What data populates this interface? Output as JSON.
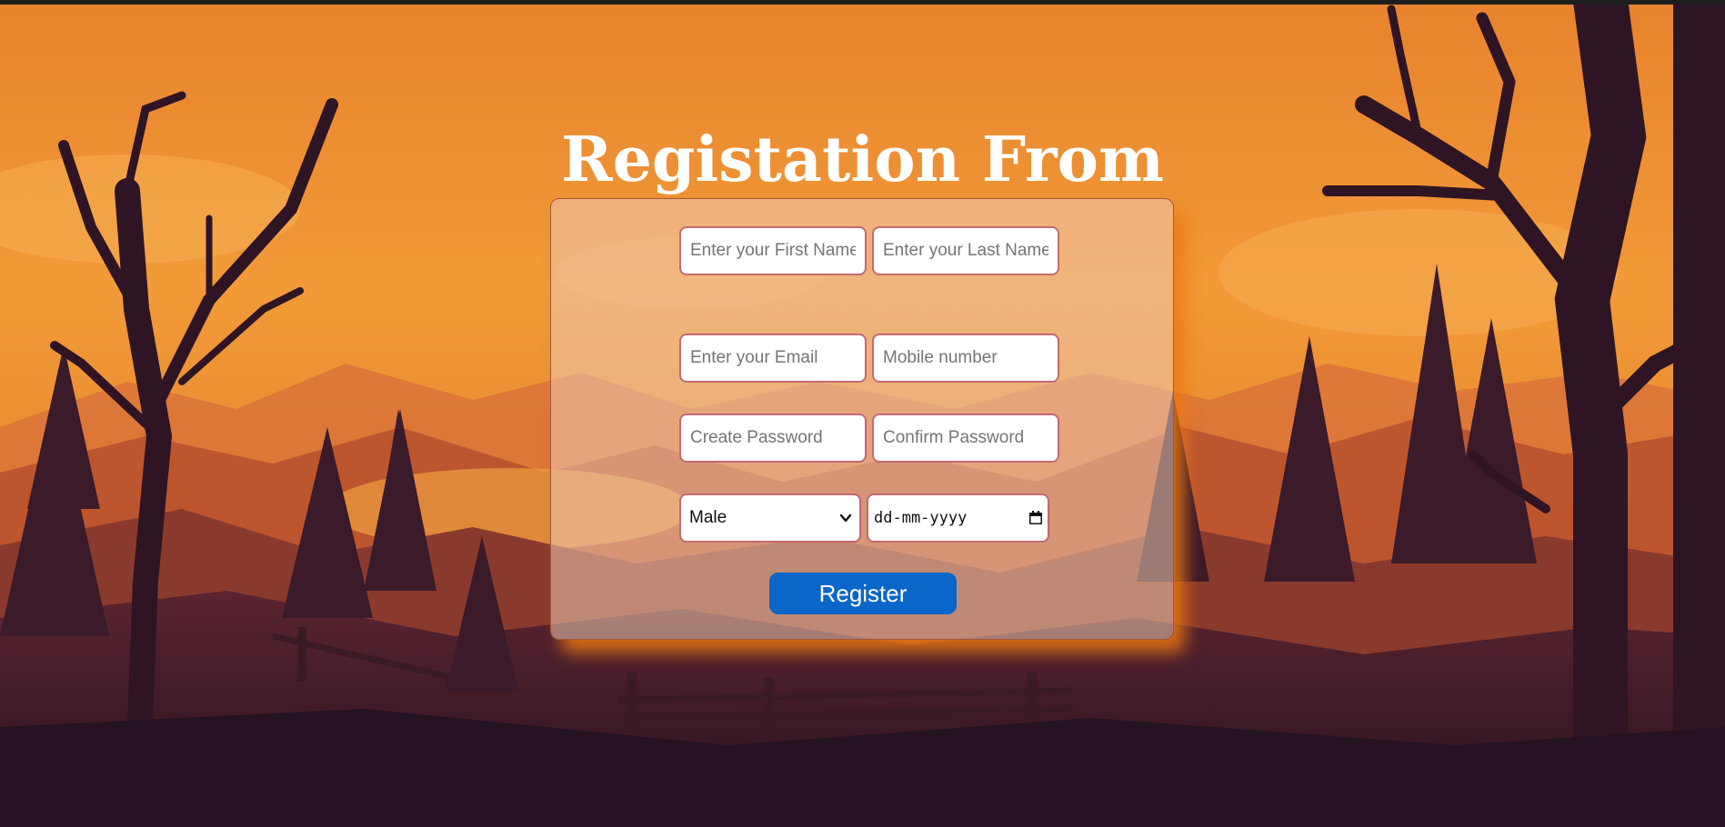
{
  "page": {
    "title": "Registation From"
  },
  "form": {
    "first_name_placeholder": "Enter your First Name",
    "last_name_placeholder": "Enter your Last Name",
    "email_placeholder": "Enter your Email",
    "mobile_placeholder": "Mobile number",
    "password_placeholder": "Create Password",
    "confirm_password_placeholder": "Confirm Password",
    "gender_selected": "Male",
    "dob_placeholder": "dd-mm-yyyy",
    "register_label": "Register"
  },
  "colors": {
    "sky_top": "#e8862e",
    "sky_mid": "#f2a03c",
    "silhouette": "#2d1624",
    "button": "#0a66c8",
    "field_border": "#c36a73",
    "card_glow": "#eb7814"
  },
  "icons": {
    "select_arrow": "chevron-down-icon",
    "date_picker": "calendar-icon"
  }
}
